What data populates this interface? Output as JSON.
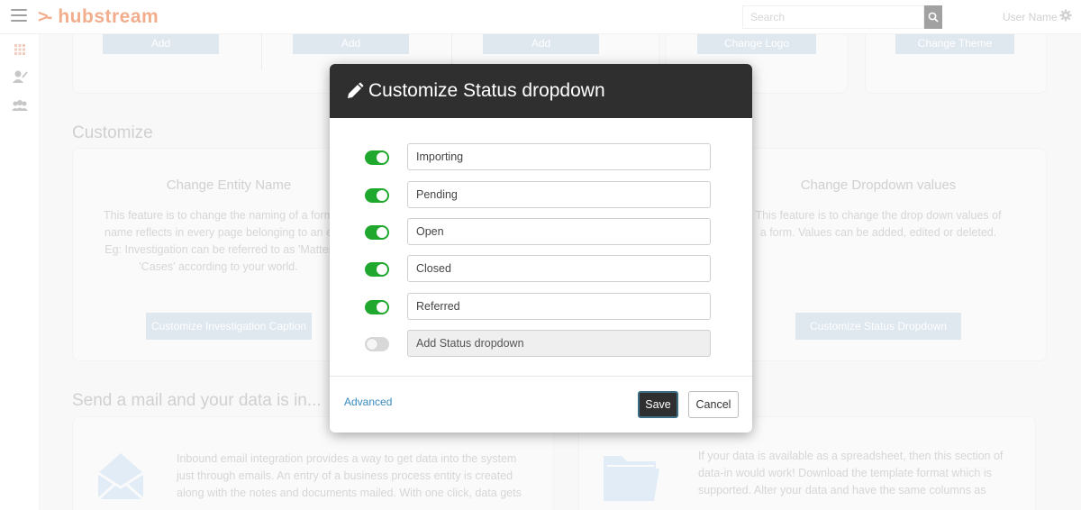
{
  "app": {
    "logo_mark": ">-",
    "logo_text": "hubstream"
  },
  "topbar": {
    "search_placeholder": "Search",
    "user_name": "User Name"
  },
  "rail": {
    "icons": [
      "grid-icon",
      "user-edit-icon",
      "users-icon"
    ]
  },
  "background": {
    "top_buttons": [
      "Add",
      "Add",
      "Add",
      "Change Logo",
      "Change Theme"
    ],
    "customize": {
      "section_title": "Customize",
      "entity_card": {
        "title": "Change Entity Name",
        "text": "This feature is to change the naming of a form name reflects in every page belonging to an e Eg: Investigation can be referred to as 'Matter 'Cases' according to your world.",
        "button": "Customize Investigation Caption"
      },
      "dropdown_card": {
        "title": "Change Dropdown values",
        "text": "This feature is to change the drop down values of a form. Values can be added, edited or deleted.",
        "button": "Customize Status Dropdown"
      }
    },
    "mail": {
      "section_title": "Send a mail and your data is in...",
      "email_text": "Inbound email integration provides a way to get data into the system just through emails. An entry of a business process entity is created along with the notes and documents mailed. With one click, data gets",
      "spreadsheet_text": "If your data is available as a spreadsheet, then this section of data-in would work! Download the template format which is supported. Alter your data and have the same columns as"
    }
  },
  "modal": {
    "title": "Customize Status dropdown",
    "rows": [
      {
        "value": "Importing",
        "enabled": true
      },
      {
        "value": "Pending",
        "enabled": true
      },
      {
        "value": "Open",
        "enabled": true
      },
      {
        "value": "Closed",
        "enabled": true
      },
      {
        "value": "Referred",
        "enabled": true
      }
    ],
    "add_placeholder": "Add Status dropdown",
    "add_enabled": false,
    "advanced_label": "Advanced",
    "save_label": "Save",
    "cancel_label": "Cancel"
  },
  "colors": {
    "accent_orange": "#e86b2e",
    "toggle_on": "#20a82e",
    "header_dark": "#2f2f2f",
    "link_blue": "#3a8bbf"
  }
}
